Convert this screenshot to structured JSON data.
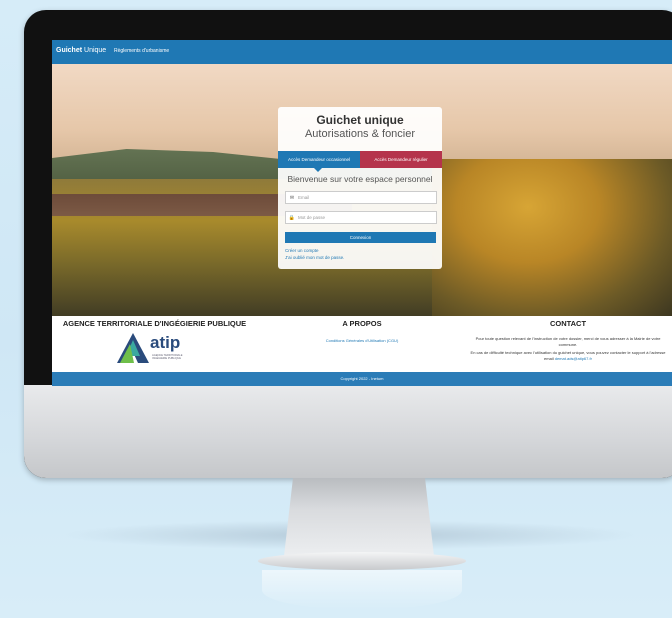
{
  "navbar": {
    "brand_bold": "Guichet",
    "brand_light": "Unique",
    "link": "Règlements d'urbanisme"
  },
  "login": {
    "title": "Guichet unique",
    "subtitle": "Autorisations & foncier",
    "tab_occasional": "Accès Demandeur occasionnel",
    "tab_regular": "Accès Demandeur régulier",
    "welcome": "Bienvenue sur votre espace personnel",
    "email_placeholder": "Email",
    "password_placeholder": "Mot de passe",
    "submit": "Connexion",
    "create_account": "Créer un compte",
    "forgot_password": "J'ai oublié mon mot de passe."
  },
  "footer": {
    "agency_title": "AGENCE TERRITORIALE D'INGÉGIERIE PUBLIQUE",
    "logo_word": "atip",
    "logo_tagline": "AGENCE TERRITORIALE INGÉGIERIE PUBLIQUE",
    "about_title": "A PROPOS",
    "about_link": "Conditions Générales d'Utilisation (CGU)",
    "contact_title": "CONTACT",
    "contact_text_1": "Pour toute question relevant de l'instruction de votre dossier, merci de vous adresser à la Mairie de votre commune.",
    "contact_text_2": "En cas de difficulté technique avec l'utilisation du guichet unique, vous pouvez contacter le support à l'adresse email",
    "contact_email": "demat.ads@atip67.fr",
    "copyright": "Copyright 2022 - Inetum"
  },
  "colors": {
    "primary": "#1f78b4",
    "accent": "#b5344c"
  }
}
